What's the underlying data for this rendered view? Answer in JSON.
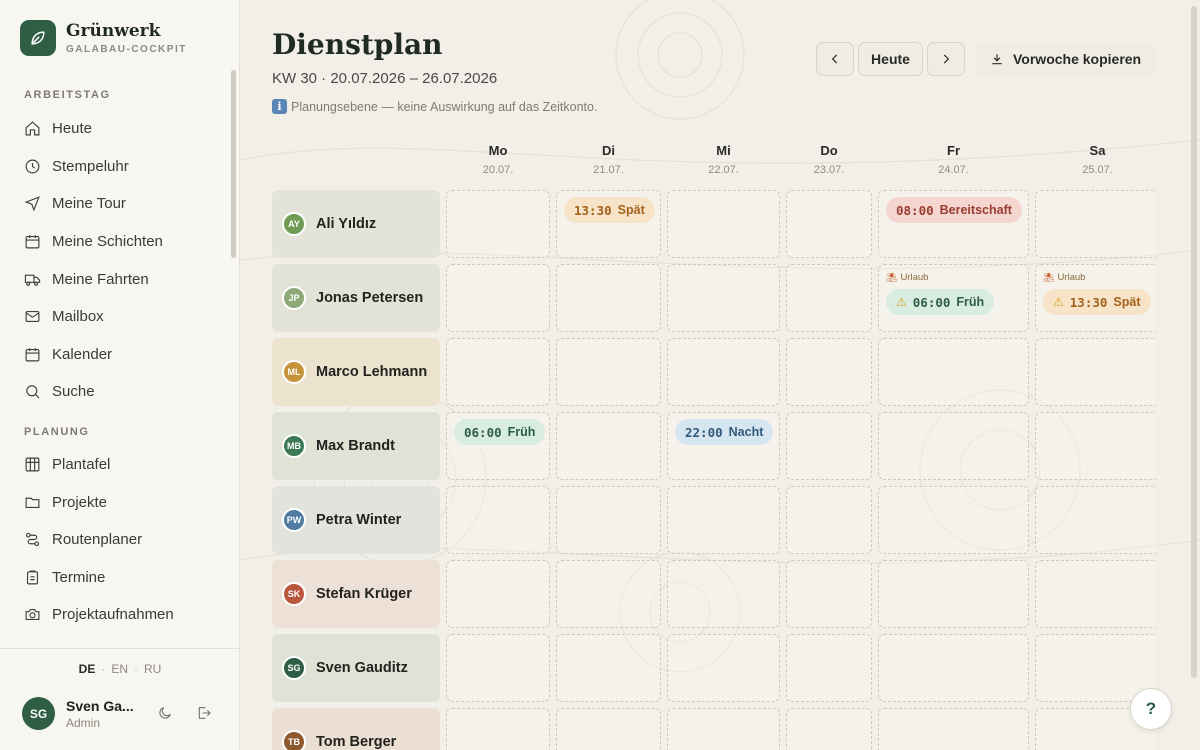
{
  "brand": {
    "name": "Grünwerk",
    "subtitle": "GALABAU-COCKPIT"
  },
  "sidebar": {
    "sections": [
      {
        "title": "ARBEITSTAG",
        "items": [
          {
            "label": "Heute",
            "icon": "home-icon"
          },
          {
            "label": "Stempeluhr",
            "icon": "clock-icon"
          },
          {
            "label": "Meine Tour",
            "icon": "navigation-icon"
          },
          {
            "label": "Meine Schichten",
            "icon": "calendar-icon"
          },
          {
            "label": "Meine Fahrten",
            "icon": "truck-icon"
          },
          {
            "label": "Mailbox",
            "icon": "mail-icon"
          },
          {
            "label": "Kalender",
            "icon": "calendar-icon"
          },
          {
            "label": "Suche",
            "icon": "search-icon"
          }
        ]
      },
      {
        "title": "PLANUNG",
        "items": [
          {
            "label": "Plantafel",
            "icon": "board-icon"
          },
          {
            "label": "Projekte",
            "icon": "folder-icon"
          },
          {
            "label": "Routenplaner",
            "icon": "route-icon"
          },
          {
            "label": "Termine",
            "icon": "clipboard-icon"
          },
          {
            "label": "Projektaufnahmen",
            "icon": "camera-icon"
          }
        ]
      }
    ],
    "languages": [
      "DE",
      "EN",
      "RU"
    ],
    "active_language": "DE",
    "user": {
      "initials": "SG",
      "name": "Sven Ga...",
      "role": "Admin"
    }
  },
  "header": {
    "title": "Dienstplan",
    "week": "KW 30 · 20.07.2026 – 26.07.2026",
    "note": "Planungsebene — keine Auswirkung auf das Zeitkonto.",
    "today_label": "Heute",
    "copy_label": "Vorwoche kopieren"
  },
  "days": [
    {
      "name": "Mo",
      "date": "20.07."
    },
    {
      "name": "Di",
      "date": "21.07."
    },
    {
      "name": "Mi",
      "date": "22.07."
    },
    {
      "name": "Do",
      "date": "23.07."
    },
    {
      "name": "Fr",
      "date": "24.07."
    },
    {
      "name": "Sa",
      "date": "25.07."
    }
  ],
  "employees": [
    {
      "initials": "AY",
      "name": "Ali Yıldız",
      "color": "#6f9b54",
      "bg": "#e3e4d7"
    },
    {
      "initials": "JP",
      "name": "Jonas Petersen",
      "color": "#8ea878",
      "bg": "#e2e3d6"
    },
    {
      "initials": "ML",
      "name": "Marco Lehmann",
      "color": "#c6923a",
      "bg": "#ece3cf"
    },
    {
      "initials": "MB",
      "name": "Max Brandt",
      "color": "#3c7a55",
      "bg": "#dfe3d6"
    },
    {
      "initials": "PW",
      "name": "Petra Winter",
      "color": "#4f7ca0",
      "bg": "#e1e3de"
    },
    {
      "initials": "SK",
      "name": "Stefan Krüger",
      "color": "#b8573e",
      "bg": "#ede0d6"
    },
    {
      "initials": "SG",
      "name": "Sven Gauditz",
      "color": "#2f5e45",
      "bg": "#dfe3d5"
    },
    {
      "initials": "TB",
      "name": "Tom Berger",
      "color": "#8c5a2e",
      "bg": "#eadfd2"
    }
  ],
  "shifts": [
    {
      "row": 0,
      "day": 1,
      "time": "13:30",
      "label": "Spät",
      "type": "spaet",
      "warning": false,
      "absence": ""
    },
    {
      "row": 0,
      "day": 4,
      "time": "08:00",
      "label": "Bereitschaft",
      "type": "bereitschaft",
      "warning": false,
      "absence": ""
    },
    {
      "row": 1,
      "day": 4,
      "time": "06:00",
      "label": "Früh",
      "type": "frueh",
      "warning": true,
      "absence": "Urlaub"
    },
    {
      "row": 1,
      "day": 5,
      "time": "13:30",
      "label": "Spät",
      "type": "spaet",
      "warning": true,
      "absence": "Urlaub"
    },
    {
      "row": 3,
      "day": 0,
      "time": "06:00",
      "label": "Früh",
      "type": "frueh",
      "warning": false,
      "absence": ""
    },
    {
      "row": 3,
      "day": 2,
      "time": "22:00",
      "label": "Nacht",
      "type": "nacht",
      "warning": false,
      "absence": ""
    }
  ],
  "shift_colors": {
    "frueh": {
      "bg": "#d9ece2",
      "fg": "#2c5e43"
    },
    "spaet": {
      "bg": "#f7e3c8",
      "fg": "#a3621c"
    },
    "nacht": {
      "bg": "#d6e6f1",
      "fg": "#33597a"
    },
    "bereitschaft": {
      "bg": "#f4d5d0",
      "fg": "#9a3c30"
    }
  },
  "help_label": "?"
}
